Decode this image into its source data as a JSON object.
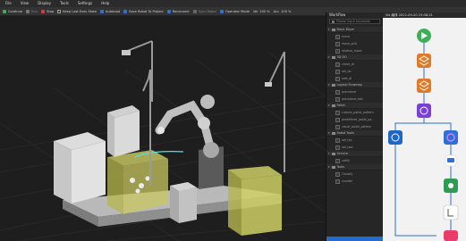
{
  "menu": [
    "File",
    "View",
    "Display",
    "Tools",
    "Settings",
    "Help"
  ],
  "toolbar": {
    "continue": "Continue",
    "run": "Run",
    "stop": "Stop",
    "keep_last": "Keep Last Exec State",
    "autoload": "Autoload",
    "save_robot": "Save Robot To Project",
    "reconnect": "Reconnect",
    "sync_robot": "Sync Robot",
    "operator_mode": "Operator Mode",
    "vel_label": "Vel",
    "vel_value": "100 %",
    "acc_label": "Acc",
    "acc_value": "100 %"
  },
  "workflow": {
    "title": "Workflow",
    "search_placeholder": "Please input keywords",
    "groups": [
      {
        "label": "Basic Move",
        "items": [
          "move",
          "move_grid",
          "relative_move"
        ]
      },
      {
        "label": "3D DO",
        "items": [
          "check_dl",
          "set_do",
          "wait_dl"
        ]
      },
      {
        "label": "Logical Flowmap",
        "items": [
          "procedure",
          "procedure_exit"
        ]
      },
      {
        "label": "Pallet",
        "items": [
          "custom_pallet_pattern",
          "predefined_pallet_pa..",
          "visual_pallet_pattern"
        ]
      },
      {
        "label": "Robot Tools",
        "items": [
          "set_tcp",
          "set_tool"
        ]
      },
      {
        "label": "Service",
        "items": [
          "notify"
        ]
      },
      {
        "label": "Tools",
        "items": [
          "Classify",
          "counter"
        ]
      }
    ]
  },
  "canvas": {
    "title": "Vis 编排 2022-09-20 15:08:21"
  },
  "colors": {
    "start": "#3fae5b",
    "step": "#e07a28",
    "vision": "#7a3fd6",
    "loop": "#1e66c8",
    "blue_node": "#2f6fd8",
    "green_node": "#2e9a56",
    "pink_node": "#ea3b6a"
  }
}
